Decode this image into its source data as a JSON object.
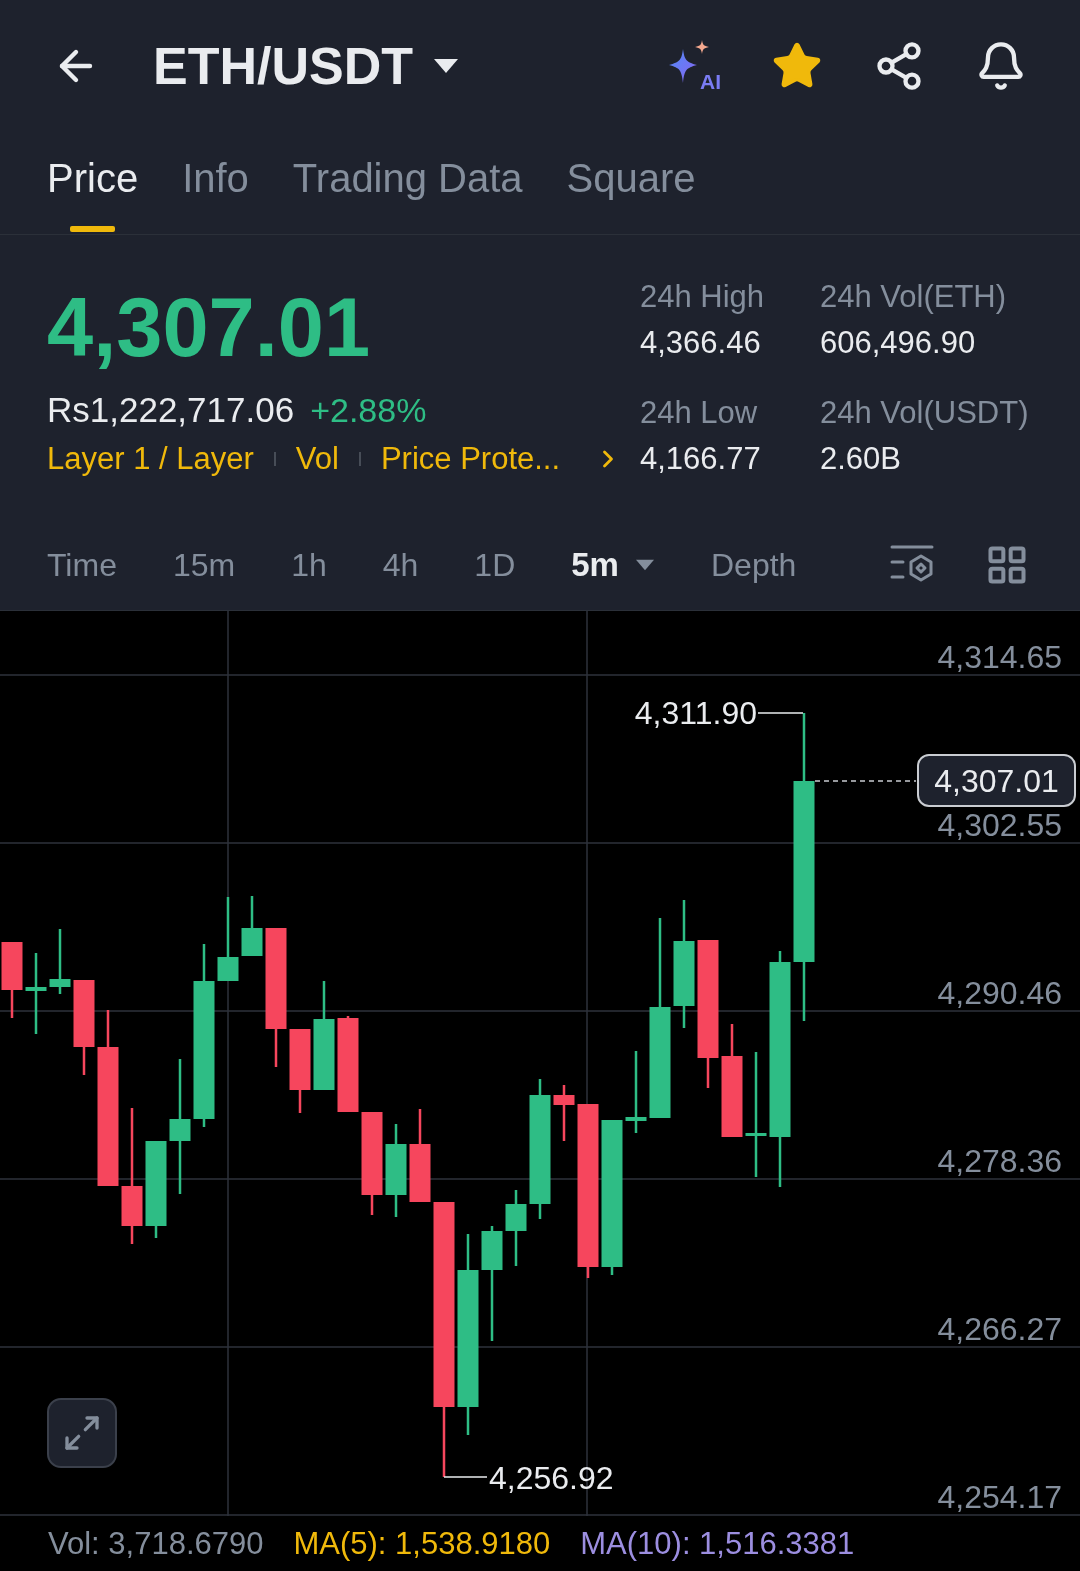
{
  "header": {
    "title": "ETH/USDT",
    "ai_label": "AI",
    "favorited": true
  },
  "tabs": [
    {
      "label": "Price",
      "selected": true
    },
    {
      "label": "Info",
      "selected": false
    },
    {
      "label": "Trading Data",
      "selected": false
    },
    {
      "label": "Square",
      "selected": false
    }
  ],
  "ticker": {
    "price": "4,307.01",
    "rising": true,
    "fiat_price": "Rs1,222,717.06",
    "change": "+2.88%",
    "tags": [
      "Layer 1 / Layer",
      "Vol",
      "Price Prote..."
    ]
  },
  "stats": [
    {
      "label": "24h High",
      "value": "4,366.46"
    },
    {
      "label": "24h Vol(ETH)",
      "value": "606,496.90"
    },
    {
      "label": "24h Low",
      "value": "4,166.77"
    },
    {
      "label": "24h Vol(USDT)",
      "value": "2.60B"
    }
  ],
  "intervals": [
    {
      "label": "Time",
      "selected": false,
      "dropdown": false
    },
    {
      "label": "15m",
      "selected": false,
      "dropdown": false
    },
    {
      "label": "1h",
      "selected": false,
      "dropdown": false
    },
    {
      "label": "4h",
      "selected": false,
      "dropdown": false
    },
    {
      "label": "1D",
      "selected": false,
      "dropdown": false
    },
    {
      "label": "5m",
      "selected": true,
      "dropdown": true
    },
    {
      "label": "Depth",
      "selected": false,
      "dropdown": false
    }
  ],
  "chart": {
    "price_axis": [
      "4,314.65",
      "4,302.55",
      "4,290.46",
      "4,278.36",
      "4,266.27",
      "4,254.17"
    ],
    "high_marker": "4,311.90",
    "low_marker": "4,256.92",
    "last_price": "4,307.01"
  },
  "indicators": [
    {
      "label": "Vol: 3,718.6790",
      "color": "#848e9c"
    },
    {
      "label": "MA(5): 1,538.9180",
      "color": "#f0b90b"
    },
    {
      "label": "MA(10): 1,516.3381",
      "color": "#9c8ee0"
    }
  ]
}
